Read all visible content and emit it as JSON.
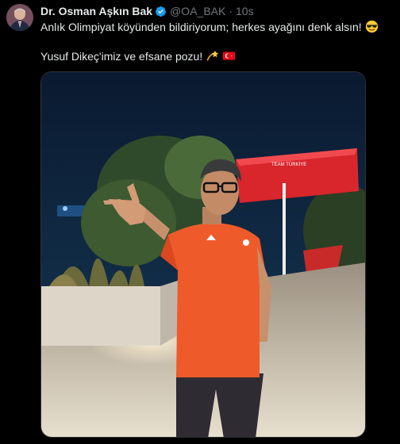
{
  "author": {
    "display_name": "Dr. Osman Aşkın Bak",
    "handle": "@OA_BAK",
    "separator": "·",
    "time_ago": "10s",
    "avatar_icon": "profile-avatar",
    "verified_icon": "verified-badge-icon"
  },
  "tweet": {
    "line1": "Anlık Olimpiyat köyünden bildiriyorum; herkes ayağını denk alsın!",
    "line1_emoji": "sunglasses-face-emoji",
    "line2": "Yusuf Dikeç'imiz ve efsane pozu!",
    "line2_emojis": [
      "dizzy-star-emoji",
      "turkey-flag-emoji"
    ]
  },
  "media": {
    "type": "photo",
    "description_icon": "photo",
    "umbrella_text": "TEAM TÜRKİYE"
  },
  "colors": {
    "background": "#000000",
    "text": "#e7e9ea",
    "secondary_text": "#71767b",
    "verified": "#1d9bf0"
  }
}
